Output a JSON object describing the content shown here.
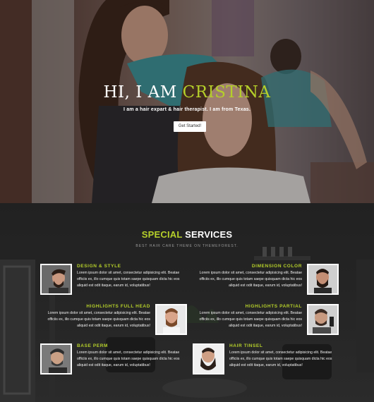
{
  "hero": {
    "title_prefix": "HI, I AM ",
    "title_accent": "CRISTINA",
    "subtitle": "I am a hair expart & hair therapist. I am from Texas.",
    "button_label": "Get Started!"
  },
  "services": {
    "title_accent": "SPECIAL",
    "title_rest": " SERVICES",
    "subtitle": "BEST HAIR CARE THEME ON THEMEFOREST.",
    "items": [
      {
        "name": "DESIGN & STYLE",
        "desc": "Lorem ipsum dolor sit amet, consectetur adipisicing elit. Beatae officiis ex, illo cumque quis totam saepe quisquam dicta hic eos aliquid est odit itaque, earum id, voluptatibus!"
      },
      {
        "name": "DIMENSION COLOR",
        "desc": "Lorem ipsum dolor sit amet, consectetur adipisicing elit. Beatae officiis ex, illo cumque quis totam saepe quisquam dicta hic eos aliquid est odit itaque, earum id, voluptatibus!"
      },
      {
        "name": "HIGHLIGHTS FULL HEAD",
        "desc": "Lorem ipsum dolor sit amet, consectetur adipisicing elit. Beatae officiis ex, illo cumque quis totam saepe quisquam dicta hic eos aliquid est odit itaque, earum id, voluptatibus!"
      },
      {
        "name": "HIGHLIGHTS PARTIAL",
        "desc": "Lorem ipsum dolor sit amet, consectetur adipisicing elit. Beatae officiis ex, illo cumque quis totam saepe quisquam dicta hic eos aliquid est odit itaque, earum id, voluptatibus!"
      },
      {
        "name": "BASE PERM",
        "desc": "Lorem ipsum dolor sit amet, consectetur adipisicing elit. Beatae officiis ex, illo cumque quis totam saepe quisquam dicta hic eos aliquid est odit itaque, earum id, voluptatibus!"
      },
      {
        "name": "HAIR TINSEL",
        "desc": "Lorem ipsum dolor sit amet, consectetur adipisicing elit. Beatae officiis ex, illo cumque quis totam saepe quisquam dicta hic eos aliquid est odit itaque, earum id, voluptatibus!"
      }
    ]
  },
  "colors": {
    "accent": "#b5cf2a",
    "dark_bg": "#262626",
    "text_light": "#ffffff"
  }
}
